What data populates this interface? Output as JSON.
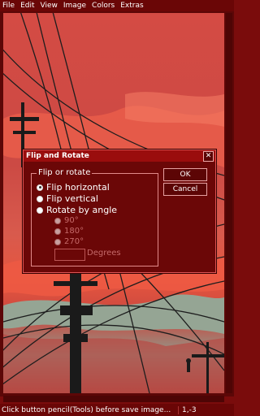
{
  "menu": [
    "File",
    "Edit",
    "View",
    "Image",
    "Colors",
    "Extras"
  ],
  "dialog": {
    "title": "Flip and Rotate",
    "close": "✕",
    "group_label": "Flip or rotate",
    "options": [
      "Flip horizontal",
      "Flip vertical",
      "Rotate by angle"
    ],
    "angles": [
      "90°",
      "180°",
      "270°"
    ],
    "degrees_label": "Degrees",
    "ok": "OK",
    "cancel": "Cancel"
  },
  "status": {
    "message": "Click button pencil(Tools) before save image...",
    "coords": "1,-3"
  }
}
